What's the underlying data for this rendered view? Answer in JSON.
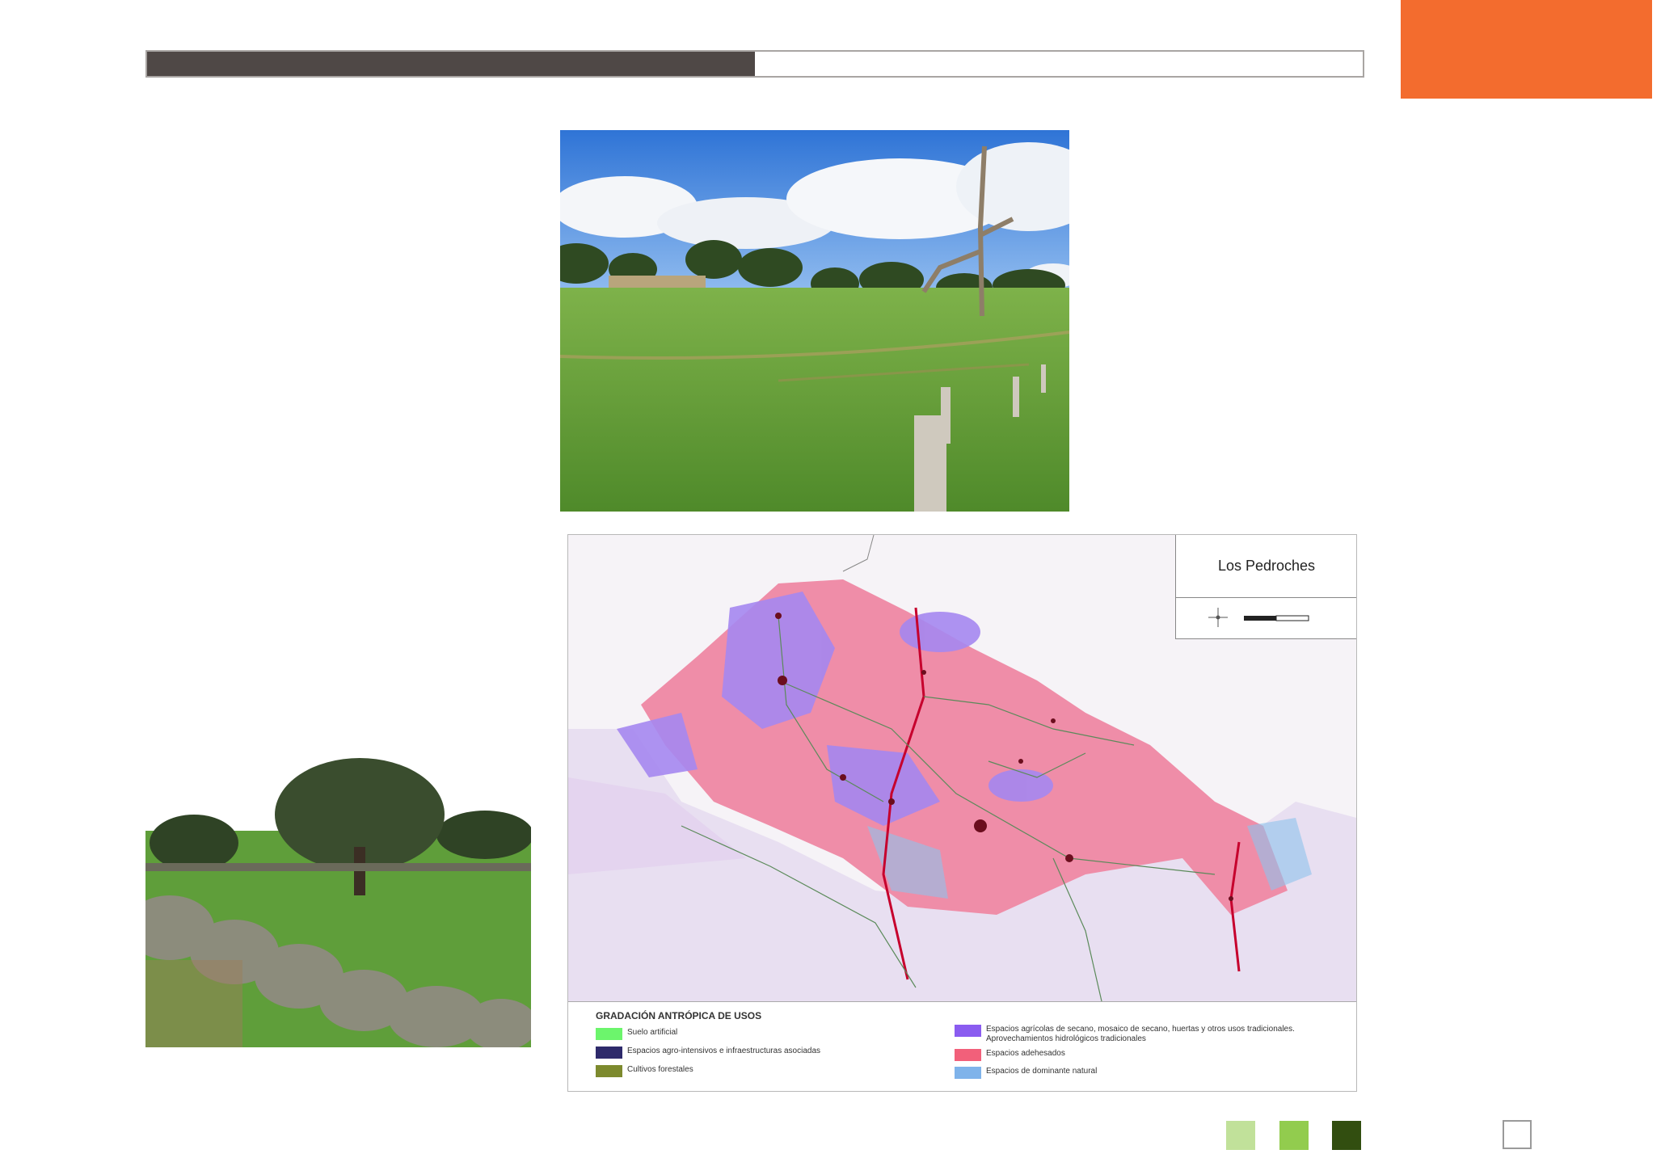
{
  "header": {
    "progress": 0.5
  },
  "photos": {
    "top": {
      "icon": "dehesa-landscape-photo"
    },
    "bottom_left": {
      "icon": "holm-oak-photo"
    }
  },
  "map": {
    "title": "Los Pedroches",
    "legend": {
      "title": "GRADACIÓN ANTRÓPICA DE USOS",
      "items": [
        {
          "label": "Suelo artificial",
          "color": "#6cf56c"
        },
        {
          "label": "Espacios agro-intensivos e infraestructuras asociadas",
          "color": "#2e2a6b"
        },
        {
          "label": "Cultivos forestales",
          "color": "#7d8a2e"
        },
        {
          "label": "Espacios agrícolas de secano, mosaico de secano, huertas y otros usos tradicionales.",
          "label2": "Aprovechamientos hidrológicos tradicionales",
          "color": "#8a5cf0"
        },
        {
          "label": "Espacios adehesados",
          "color": "#f2607a"
        },
        {
          "label": "Espacios de dominante natural",
          "color": "#7fb3ea"
        }
      ]
    }
  },
  "footer": {
    "squares": [
      "#c1e19a",
      "#92cc4e",
      "#324e10"
    ]
  }
}
